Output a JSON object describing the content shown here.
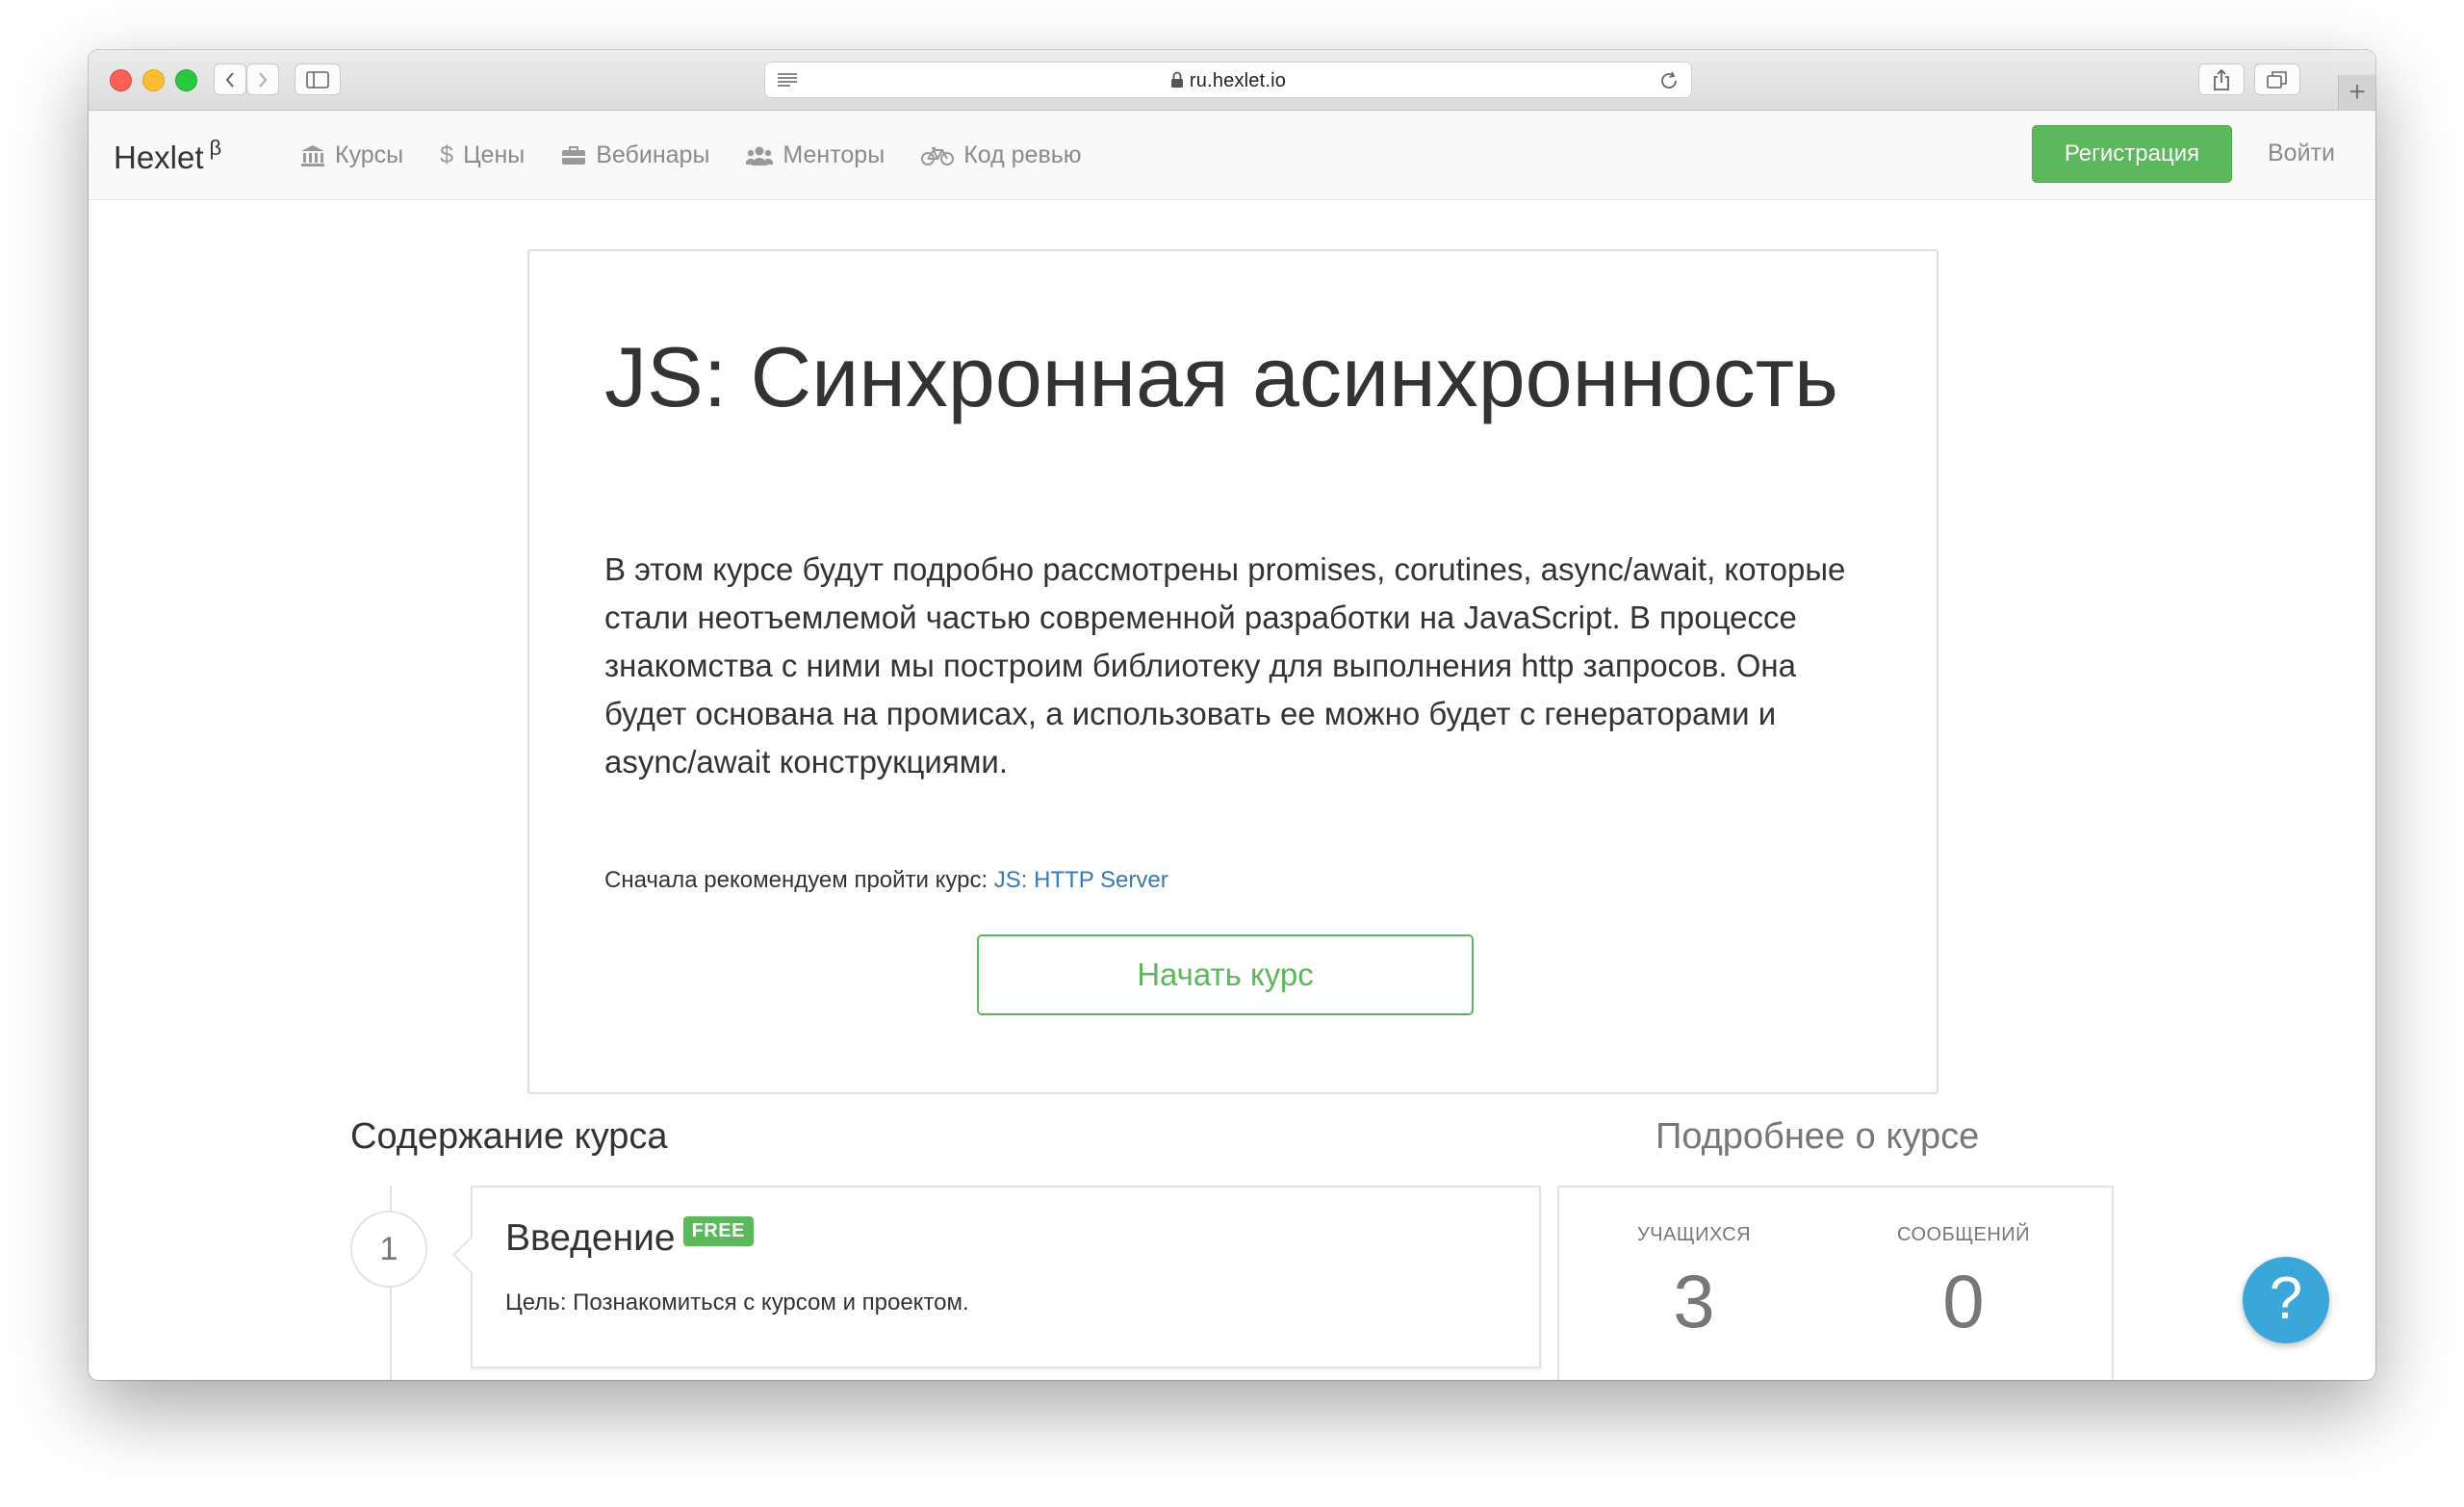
{
  "browser": {
    "url": "ru.hexlet.io",
    "icons": [
      "back-icon",
      "forward-icon",
      "sidebar-icon",
      "reader-icon",
      "lock-icon",
      "reload-icon",
      "share-icon",
      "tabs-icon",
      "plus-icon"
    ]
  },
  "nav": {
    "brand": "Hexlet",
    "brand_sup": "β",
    "links": [
      {
        "label": "Курсы",
        "icon": "bank-icon"
      },
      {
        "label": "Цены",
        "icon": "dollar-icon"
      },
      {
        "label": "Вебинары",
        "icon": "briefcase-icon"
      },
      {
        "label": "Менторы",
        "icon": "users-icon"
      },
      {
        "label": "Код ревью",
        "icon": "bicycle-icon"
      }
    ],
    "register": "Регистрация",
    "login": "Войти",
    "accent": "#5cb85c"
  },
  "course": {
    "title": "JS: Синхронная асинхронность",
    "description": "В этом курсе будут подробно рассмотрены promises, corutines, async/await, которые стали неотъемлемой частью современной разработки на JavaScript. В процессе знакомства с ними мы построим библиотеку для выполнения http запросов. Она будет основана на промисах, а использовать ее можно будет с генераторами и async/await конструкциями.",
    "recommend_prefix": "Сначала рекомендуем пройти курс:",
    "recommend_link": "JS: HTTP Server",
    "start_button": "Начать курс"
  },
  "contents": {
    "heading": "Содержание курса",
    "lessons": [
      {
        "number": "1",
        "title": "Введение",
        "badge": "FREE",
        "goal": "Цель: Познакомиться с курсом и проектом."
      }
    ]
  },
  "about": {
    "heading": "Подробнее о курсе",
    "students_label": "УЧАЩИХСЯ",
    "students_value": "3",
    "messages_label": "СООБЩЕНИЙ",
    "messages_value": "0"
  },
  "help": {
    "label": "?",
    "color": "#3aa6da"
  }
}
